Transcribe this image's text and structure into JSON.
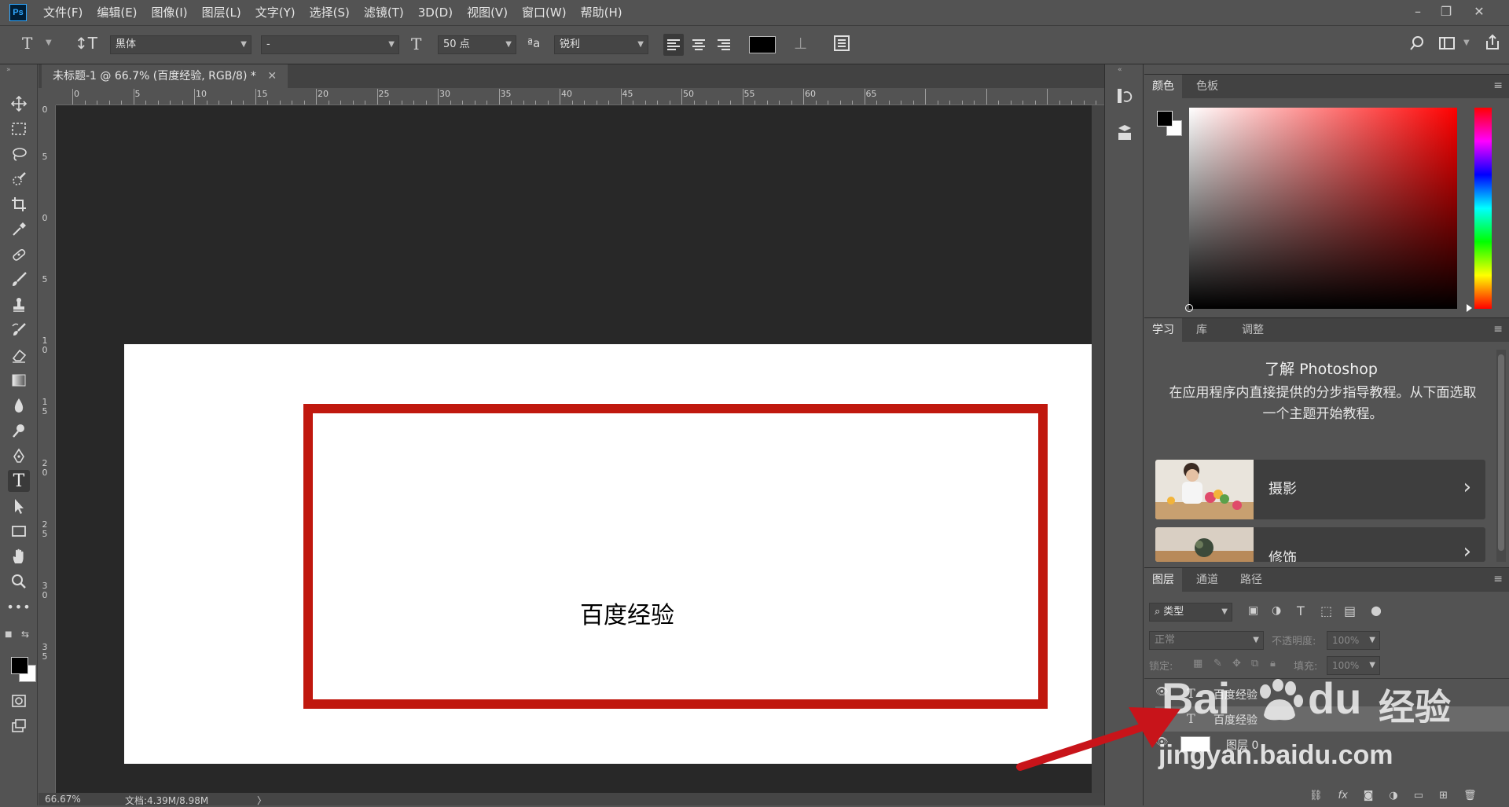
{
  "app": {
    "logo": "Ps",
    "menu": [
      "文件(F)",
      "编辑(E)",
      "图像(I)",
      "图层(L)",
      "文字(Y)",
      "选择(S)",
      "滤镜(T)",
      "3D(D)",
      "视图(V)",
      "窗口(W)",
      "帮助(H)"
    ]
  },
  "options": {
    "font_family": "黑体",
    "font_style": "-",
    "font_size": "50 点",
    "antialias": "锐利",
    "text_color": "#000000"
  },
  "document": {
    "tab_title": "未标题-1 @ 66.7% (百度经验, RGB/8) *",
    "canvas_text": "百度经验",
    "frame_color": "#c0180e",
    "ruler_top_labels": [
      "0",
      "5",
      "10",
      "15",
      "20",
      "25",
      "30",
      "35",
      "40",
      "45",
      "50",
      "55",
      "60",
      "65"
    ],
    "ruler_left_labels": [
      "0",
      "5",
      "0",
      "5",
      "1 0",
      "1 5",
      "2 0",
      "2 5",
      "3 0",
      "3 5"
    ]
  },
  "status": {
    "zoom": "66.67%",
    "doc_info": "文档:4.39M/8.98M",
    "arrow": "〉"
  },
  "color_panel": {
    "tabs": [
      "颜色",
      "色板"
    ],
    "hue_color": "#ff0000",
    "foreground": "#000000",
    "background": "#ffffff"
  },
  "learn_panel": {
    "tabs": [
      "学习",
      "库",
      "调整"
    ],
    "title": "了解 Photoshop",
    "description": "在应用程序内直接提供的分步指导教程。从下面选取一个主题开始教程。",
    "topics": [
      "摄影",
      "修饰"
    ]
  },
  "layers_panel": {
    "tabs": [
      "图层",
      "通道",
      "路径"
    ],
    "filter_label": "类型",
    "blend_mode": "正常",
    "opacity_label": "不透明度:",
    "opacity_value": "100%",
    "lock_label": "锁定:",
    "fill_label": "填充:",
    "fill_value": "100%",
    "layers": [
      {
        "name": "百度经验",
        "type": "text"
      },
      {
        "name": "百度经验",
        "type": "text"
      },
      {
        "name": "图层 0",
        "type": "pixel"
      }
    ]
  },
  "watermark": {
    "brand": "Bai",
    "brand2": "du",
    "brand3": "经验",
    "url": "jingyan.baidu.com"
  }
}
